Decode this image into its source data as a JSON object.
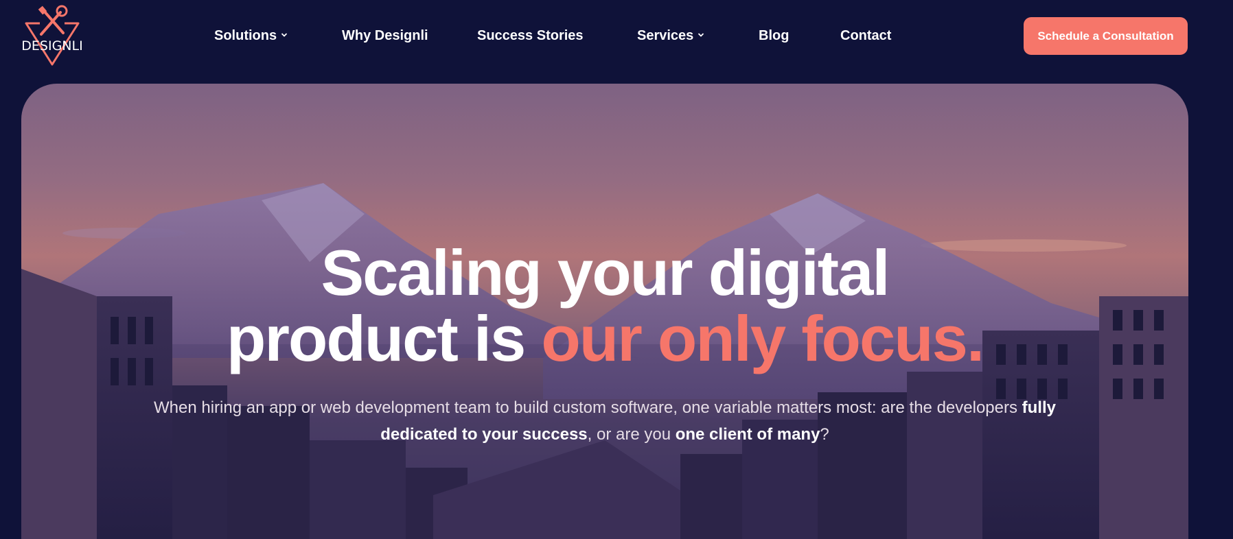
{
  "brand": {
    "logo_text": "DESIGNLI",
    "accent_color": "#f6766a",
    "background_color": "#0f1239"
  },
  "nav": {
    "items": [
      {
        "label": "Solutions",
        "has_dropdown": true
      },
      {
        "label": "Why Designli",
        "has_dropdown": false
      },
      {
        "label": "Success Stories",
        "has_dropdown": false
      },
      {
        "label": "Services",
        "has_dropdown": true
      },
      {
        "label": "Blog",
        "has_dropdown": false
      },
      {
        "label": "Contact",
        "has_dropdown": false
      }
    ],
    "cta_label": "Schedule a Consultation"
  },
  "hero": {
    "headline_line1": "Scaling your digital",
    "headline_line2_plain": "product is ",
    "headline_line2_accent": "our only focus.",
    "sub_part1": "When hiring an app or web development team to build custom software, one variable matters most: are the developers ",
    "sub_bold1": "fully dedicated to your success",
    "sub_part2": ", or are you ",
    "sub_bold2": "one client of many",
    "sub_part3": "?"
  }
}
